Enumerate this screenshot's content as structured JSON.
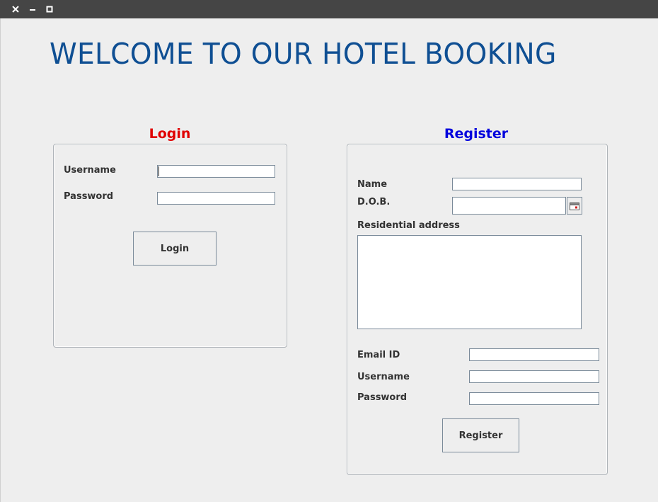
{
  "window": {
    "controls": {
      "close_icon": "close-icon",
      "minimize_icon": "minimize-icon",
      "maximize_icon": "maximize-icon"
    }
  },
  "header": {
    "title": "WELCOME TO OUR HOTEL BOOKING",
    "title_color": "#0f4f93"
  },
  "login": {
    "title": "Login",
    "title_color": "#e00000",
    "username_label": "Username",
    "username_value": "",
    "password_label": "Password",
    "password_value": "",
    "button_label": "Login"
  },
  "register": {
    "title": "Register",
    "title_color": "#0000dd",
    "name_label": "Name",
    "name_value": "",
    "dob_label": "D.O.B.",
    "dob_value": "",
    "calendar_icon": "calendar-icon",
    "address_label": "Residential address",
    "address_value": "",
    "email_label": "Email ID",
    "email_value": "",
    "username_label": "Username",
    "username_value": "",
    "password_label": "Password",
    "password_value": "",
    "button_label": "Register"
  }
}
